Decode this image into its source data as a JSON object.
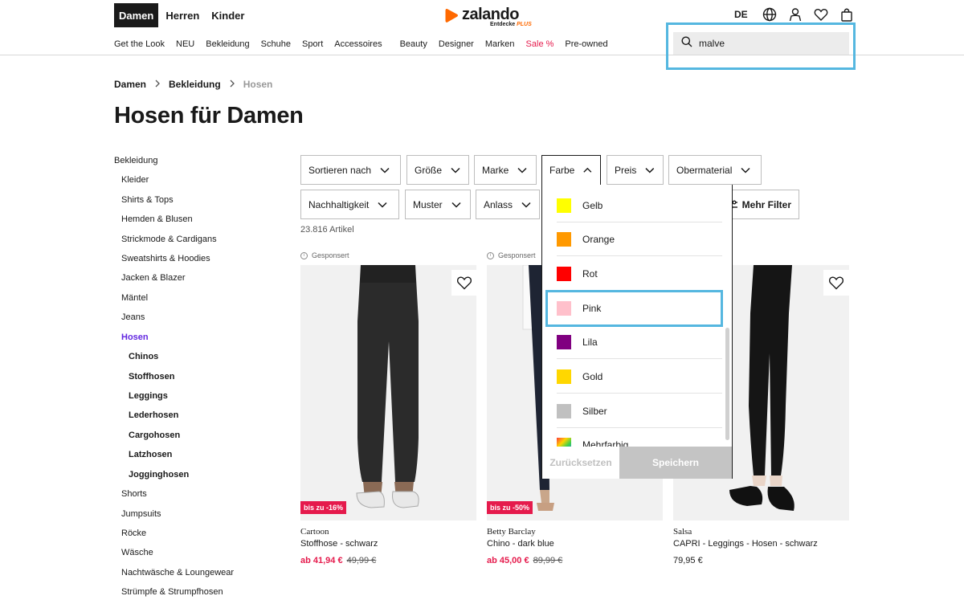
{
  "header": {
    "gender_tabs": [
      "Damen",
      "Herren",
      "Kinder"
    ],
    "logo": {
      "wordmark": "zalando",
      "tagline_prefix": "Entdecke",
      "tagline_suffix": "PLUS"
    },
    "language": "DE",
    "nav": [
      "Get the Look",
      "NEU",
      "Bekleidung",
      "Schuhe",
      "Sport",
      "Accessoires",
      "Beauty",
      "Designer",
      "Marken",
      "Sale %",
      "Pre-owned"
    ],
    "search": {
      "value": "malve"
    },
    "icons": [
      "globe-icon",
      "user-icon",
      "heart-icon",
      "bag-icon"
    ]
  },
  "breadcrumb": [
    "Damen",
    "Bekleidung",
    "Hosen"
  ],
  "page_title": "Hosen für Damen",
  "sidebar": {
    "items": [
      {
        "label": "Bekleidung",
        "level": 0
      },
      {
        "label": "Kleider",
        "level": 1
      },
      {
        "label": "Shirts & Tops",
        "level": 1
      },
      {
        "label": "Hemden & Blusen",
        "level": 1
      },
      {
        "label": "Strickmode & Cardigans",
        "level": 1
      },
      {
        "label": "Sweatshirts & Hoodies",
        "level": 1
      },
      {
        "label": "Jacken & Blazer",
        "level": 1
      },
      {
        "label": "Mäntel",
        "level": 1
      },
      {
        "label": "Jeans",
        "level": 1
      },
      {
        "label": "Hosen",
        "level": 1,
        "active": true
      },
      {
        "label": "Chinos",
        "level": 2
      },
      {
        "label": "Stoffhosen",
        "level": 2
      },
      {
        "label": "Leggings",
        "level": 2
      },
      {
        "label": "Lederhosen",
        "level": 2
      },
      {
        "label": "Cargohosen",
        "level": 2
      },
      {
        "label": "Latzhosen",
        "level": 2
      },
      {
        "label": "Jogginghosen",
        "level": 2
      },
      {
        "label": "Shorts",
        "level": 1
      },
      {
        "label": "Jumpsuits",
        "level": 1
      },
      {
        "label": "Röcke",
        "level": 1
      },
      {
        "label": "Wäsche",
        "level": 1
      },
      {
        "label": "Nachtwäsche & Loungewear",
        "level": 1
      },
      {
        "label": "Strümpfe & Strumpfhosen",
        "level": 1
      }
    ]
  },
  "filters": {
    "row1": [
      "Sortieren nach",
      "Größe",
      "Marke",
      "Farbe",
      "Preis",
      "Obermaterial"
    ],
    "row2": [
      "Nachhaltigkeit",
      "Muster",
      "Anlass"
    ],
    "more": "Mehr Filter",
    "open": "Farbe"
  },
  "article_count": "23.816 Artikel",
  "color_dropdown": {
    "options": [
      {
        "label": "Gelb",
        "color": "#ffff00"
      },
      {
        "label": "Orange",
        "color": "#ff9900"
      },
      {
        "label": "Rot",
        "color": "#ff0000"
      },
      {
        "label": "Pink",
        "color": "#ffc0cb"
      },
      {
        "label": "Lila",
        "color": "#800080"
      },
      {
        "label": "Gold",
        "color": "#ffd700"
      },
      {
        "label": "Silber",
        "color": "#c0c0c0"
      },
      {
        "label": "Mehrfarbig",
        "color": "multi"
      }
    ],
    "highlighted": "Pink",
    "reset_label": "Zurücksetzen",
    "save_label": "Speichern"
  },
  "products": [
    {
      "sponsored": "Gesponsert",
      "badge": "bis zu -16%",
      "brand": "Cartoon",
      "name": "Stoffhose - schwarz",
      "price": "ab 41,94 €",
      "old_price": "49,99 €"
    },
    {
      "sponsored": "Gesponsert",
      "badge": "bis zu -50%",
      "brand": "Betty Barclay",
      "name": "Chino - dark blue",
      "price": "ab 45,00 €",
      "old_price": "89,99 €"
    },
    {
      "brand": "Salsa",
      "name": "CAPRI - Leggings - Hosen - schwarz",
      "price": "79,95 €"
    }
  ],
  "colors": {
    "accent_purple": "#6328e0",
    "sale_red": "#e51a4c",
    "highlight_blue": "#55b7e0",
    "brand_orange": "#ff6900"
  }
}
